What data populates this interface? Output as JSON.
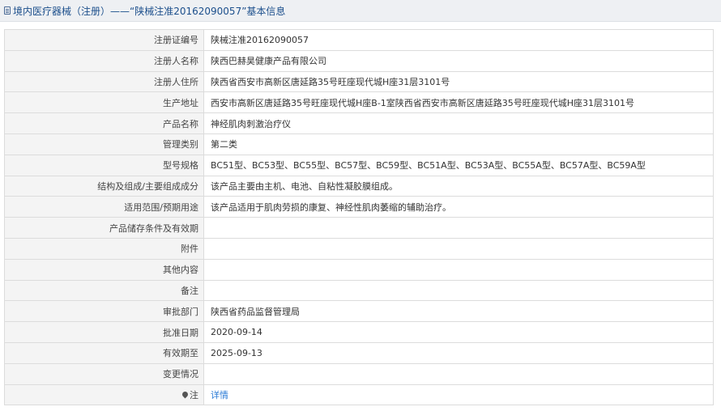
{
  "header": {
    "icon": "document-icon",
    "title": "境内医疗器械（注册）——“陕械注准20162090057”基本信息"
  },
  "rows": [
    {
      "label": "注册证编号",
      "value": "陕械注准20162090057"
    },
    {
      "label": "注册人名称",
      "value": "陕西巴赫昊健康产品有限公司"
    },
    {
      "label": "注册人住所",
      "value": "陕西省西安市高新区唐延路35号旺座现代城H座31层3101号"
    },
    {
      "label": "生产地址",
      "value": "西安市高新区唐延路35号旺座现代城H座B-1室陕西省西安市高新区唐延路35号旺座现代城H座31层3101号"
    },
    {
      "label": "产品名称",
      "value": "神经肌肉刺激治疗仪"
    },
    {
      "label": "管理类别",
      "value": "第二类"
    },
    {
      "label": "型号规格",
      "value": "BC51型、BC53型、BC55型、BC57型、BC59型、BC51A型、BC53A型、BC55A型、BC57A型、BC59A型"
    },
    {
      "label": "结构及组成/主要组成成分",
      "value": "该产品主要由主机、电池、自粘性凝胶膜组成。"
    },
    {
      "label": "适用范围/预期用途",
      "value": "该产品适用于肌肉劳损的康复、神经性肌肉萎缩的辅助治疗。"
    },
    {
      "label": "产品储存条件及有效期",
      "value": ""
    },
    {
      "label": "附件",
      "value": ""
    },
    {
      "label": "其他内容",
      "value": ""
    },
    {
      "label": "备注",
      "value": ""
    },
    {
      "label": "审批部门",
      "value": "陕西省药品监督管理局"
    },
    {
      "label": "批准日期",
      "value": "2020-09-14"
    },
    {
      "label": "有效期至",
      "value": "2025-09-13"
    },
    {
      "label": "变更情况",
      "value": ""
    }
  ],
  "note": {
    "icon": "pin-icon",
    "label": "注",
    "link_text": "详情",
    "link_color": "#2b7bd6"
  },
  "colors": {
    "header_bg": "#eef0f3",
    "header_text": "#1c4f8c",
    "label_bg": "#f4f4f4",
    "border": "#dcdcdc"
  }
}
